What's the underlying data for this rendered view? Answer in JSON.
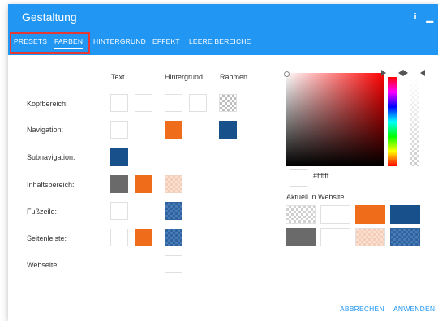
{
  "dialog": {
    "title": "Gestaltung",
    "header_icons": [
      "info-icon",
      "minimize-icon"
    ],
    "info_glyph": "i",
    "minimize_glyph": "▁"
  },
  "tabs": [
    {
      "label": "PRESETS",
      "active": false
    },
    {
      "label": "FARBEN",
      "active": true
    },
    {
      "label": "HINTERGRUND",
      "active": false
    },
    {
      "label": "EFFEKT",
      "active": false
    },
    {
      "label": "LEERE BEREICHE",
      "active": false
    }
  ],
  "columns": {
    "text": "Text",
    "background": "Hintergrund",
    "border": "Rahmen"
  },
  "rows": [
    {
      "label": "Kopfbereich:"
    },
    {
      "label": "Navigation:"
    },
    {
      "label": "Subnavigation:"
    },
    {
      "label": "Inhaltsbereich:"
    },
    {
      "label": "Fußzeile:"
    },
    {
      "label": "Seitenleiste:"
    },
    {
      "label": "Webseite:"
    }
  ],
  "picker": {
    "hex_value": "#ffffff",
    "current_label": "Aktuell in Website"
  },
  "colors": {
    "accent": "#2196f3",
    "orange": "#ef6c1a",
    "navy": "#17508a",
    "highlight": "#e53935"
  },
  "buttons": {
    "cancel": "ABBRECHEN",
    "apply": "ANWENDEN"
  }
}
